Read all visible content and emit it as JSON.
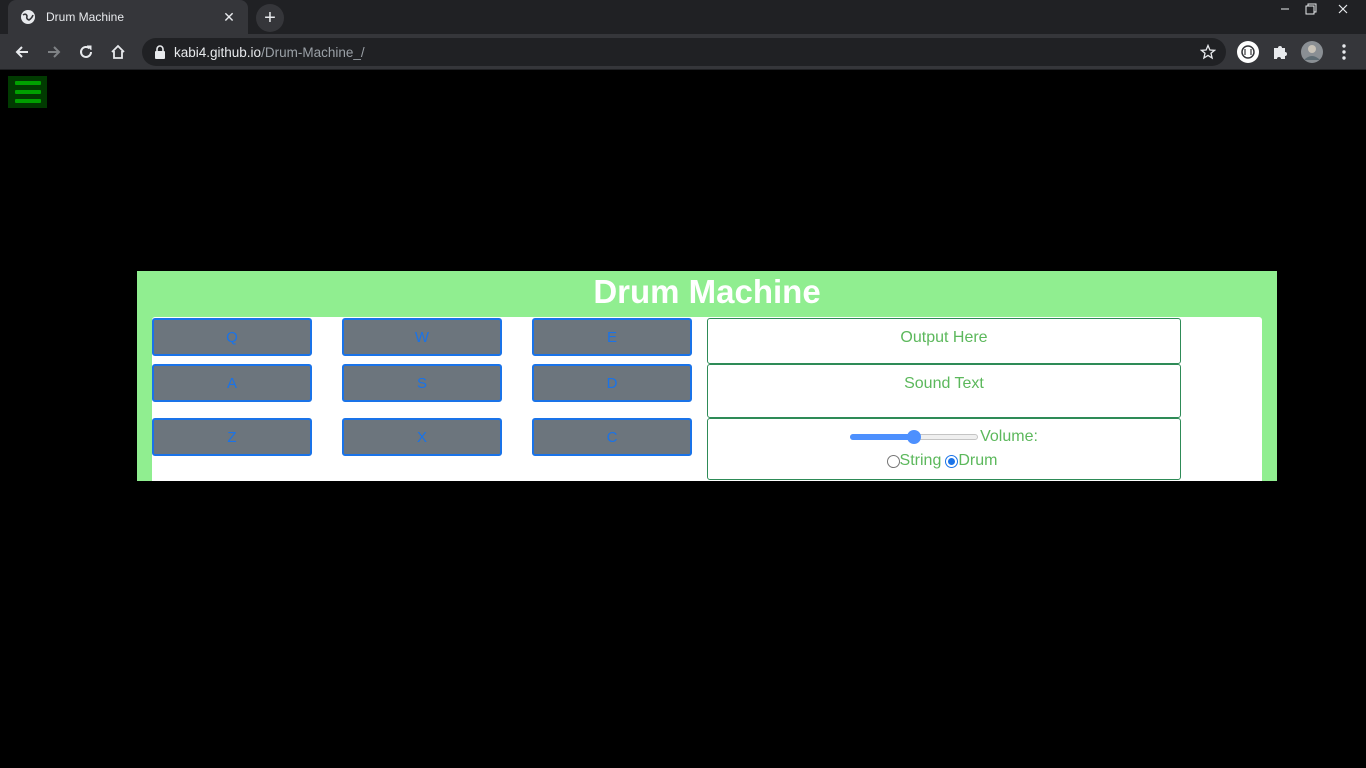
{
  "browser": {
    "tab_title": "Drum Machine",
    "tab_close": "✕",
    "new_tab": "+",
    "url_host": "kabi4.github.io",
    "url_path": "/Drum-Machine_/"
  },
  "app": {
    "title": "Drum Machine",
    "pads": [
      "Q",
      "W",
      "E",
      "A",
      "S",
      "D",
      "Z",
      "X",
      "C"
    ],
    "output_text": "Output Here",
    "sound_text": "Sound Text",
    "volume_label": "Volume:",
    "volume_value": 0.5,
    "mode_options": [
      "String",
      "Drum"
    ],
    "mode_selected": "Drum"
  },
  "colors": {
    "frame": "#90ee90",
    "pad_bg": "#6c757d",
    "pad_text": "#1a73e8",
    "panel_text": "#5cb85c",
    "hamburger": "#00a000"
  }
}
